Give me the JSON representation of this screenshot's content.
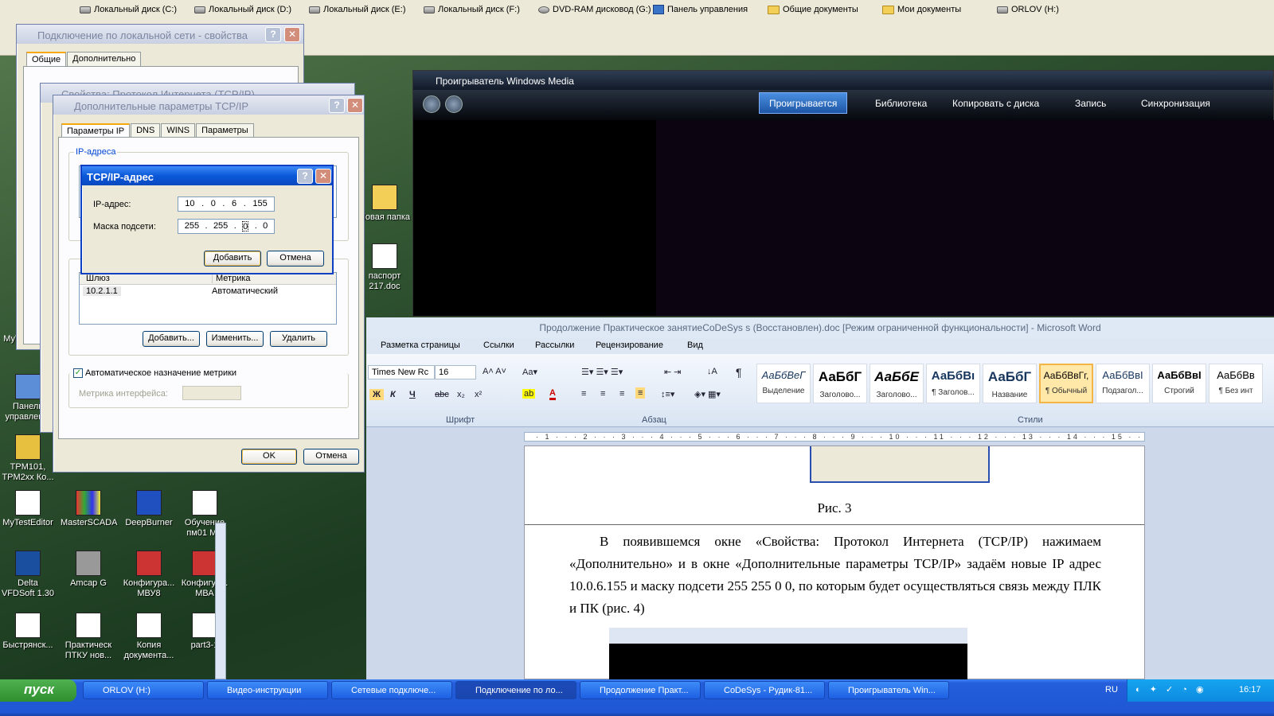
{
  "topbar": {
    "items": [
      "Локальный диск (C:)",
      "Локальный диск (D:)",
      "Локальный диск (E:)",
      "Локальный диск (F:)",
      "DVD-RAM дисковод (G:)",
      "Панель управления",
      "Общие документы",
      "Мои документы",
      "ORLOV (H:)"
    ]
  },
  "win_lan": {
    "title": "Подключение по локальной сети - свойства",
    "tabs": [
      "Общие",
      "Дополнительно"
    ]
  },
  "win_tcpip_props": {
    "title": "Свойства: Протокол Интернета (TCP/IP)"
  },
  "win_adv": {
    "title": "Дополнительные параметры TCP/IP",
    "tabs": [
      "Параметры IP",
      "DNS",
      "WINS",
      "Параметры"
    ],
    "ip_group": "IP-адреса",
    "gw_cols": [
      "Шлюз",
      "Метрика"
    ],
    "gw_row": [
      "10.2.1.1",
      "Автоматический"
    ],
    "btn_add": "Добавить...",
    "btn_edit": "Изменить...",
    "btn_del": "Удалить",
    "auto_metric": "Автоматическое назначение метрики",
    "metric_label": "Метрика интерфейса:",
    "ok": "OK",
    "cancel": "Отмена"
  },
  "dlg_ip": {
    "title": "TCP/IP-адрес",
    "ip_label": "IP-адрес:",
    "ip": [
      "10",
      "0",
      "6",
      "155"
    ],
    "mask_label": "Маска подсети:",
    "mask": [
      "255",
      "255",
      "0",
      "0"
    ],
    "add": "Добавить",
    "cancel": "Отмена"
  },
  "wmp": {
    "title": "Проигрыватель Windows Media",
    "tabs": [
      "Проигрывается",
      "Библиотека",
      "Копировать с диска",
      "Запись",
      "Синхронизация"
    ]
  },
  "word": {
    "title": "Продолжение Практическое занятиеCoDeSys s (Восстановлен).doc [Режим ограниченной функциональности]  -  Microsoft Word",
    "tabs": [
      "Разметка страницы",
      "Ссылки",
      "Рассылки",
      "Рецензирование",
      "Вид"
    ],
    "font": "Times New Rc",
    "size": "16",
    "groups": [
      "Шрифт",
      "Абзац",
      "Стили"
    ],
    "styles": [
      {
        "s": "АаБбВеГ",
        "n": "Выделение"
      },
      {
        "s": "АаБбГ",
        "n": "Заголово..."
      },
      {
        "s": "АаБбЕ",
        "n": "Заголово..."
      },
      {
        "s": "АаБбВı",
        "n": "¶ Заголов..."
      },
      {
        "s": "АаБбГ",
        "n": "Название"
      },
      {
        "s": "АаБбВвГг,",
        "n": "¶ Обычный"
      },
      {
        "s": "АаБбВвІ",
        "n": "Подзагол..."
      },
      {
        "s": "АаБбВвІ",
        "n": "Строгий"
      },
      {
        "s": "АаБбВв",
        "n": "¶ Без инт"
      }
    ],
    "ruler": "· 1 · · · 2 · · · 3 · · · 4 · · · 5 · · · 6 · · · 7 · · · 8 · · · 9 · · · 10 · · · 11 · · · 12 · · · 13 · · · 14 · · · 15 · · · 16 · · · 17 · · · 18 · · · 19",
    "caption": "Рис. 3",
    "para": "В появившемся окне «Свойства: Протокол Интернета (TCP/IP) нажимаем «Дополнительно» и в окне «Дополнительные параметры TCP/IP» задаём новые IP  адрес 10.0.6.155 и маску подсети 255 255 0 0, по которым будет осуществляться связь между ПЛК и ПК (рис. 4)"
  },
  "desktop": [
    "Панель управлен...",
    "TPM101, TPM2xx Ко...",
    "MyTestEditor",
    "MasterSCADA",
    "DeepBurner",
    "Обучение пм01 МВ",
    "Delta VFDSoft 1.30",
    "Amcap G",
    "Конфигура... МВУ8",
    "Конфигур... МВА",
    "Быстрянск...",
    "Практическ ПТКУ нов...",
    "Копия документа...",
    "part3-1",
    "Новая папка",
    "паспорт 217.doc",
    "MyT"
  ],
  "taskbar": {
    "start": "пуск",
    "items": [
      "ORLOV (H:)",
      "Видео-инструкции",
      "Сетевые подключе...",
      "Подключение по ло...",
      "Продолжение Практ...",
      "CoDeSys - Рудик-81...",
      "Проигрыватель Win..."
    ],
    "lang": "RU",
    "clock": "16:17"
  },
  "colors": {
    "xp_blue": "#0a58d8",
    "desktop": "#2f5230",
    "taskbar": "#245edb"
  }
}
